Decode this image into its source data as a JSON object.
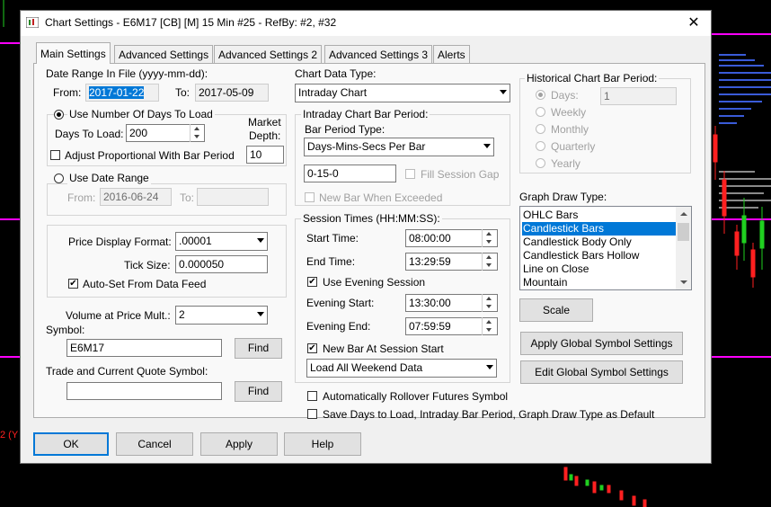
{
  "window": {
    "title": "Chart Settings - E6M17 [CB] [M]  15 Min  #25 - RefBy: #2, #32",
    "close_glyph": "✕"
  },
  "tabs": [
    {
      "label": "Main Settings",
      "active": true
    },
    {
      "label": "Advanced Settings"
    },
    {
      "label": "Advanced Settings 2"
    },
    {
      "label": "Advanced Settings 3"
    },
    {
      "label": "Alerts"
    }
  ],
  "date_range": {
    "label": "Date Range In File (yyyy-mm-dd):",
    "from_label": "From:",
    "from_value": "2017-01-22",
    "to_label": "To:",
    "to_value": "2017-05-09"
  },
  "days_group": {
    "radio_label": "Use Number Of Days To Load",
    "days_label": "Days To Load:",
    "days_value": "200",
    "market_depth_label1": "Market",
    "market_depth_label2": "Depth:",
    "market_depth_value": "10",
    "adjust_label": "Adjust Proportional With Bar Period"
  },
  "date_range_group": {
    "radio_label": "Use Date Range",
    "from_label": "From:",
    "from_value": "2016-06-24",
    "to_label": "To:",
    "to_value": ""
  },
  "price_group": {
    "format_label": "Price Display Format:",
    "format_value": ".00001",
    "tick_label": "Tick Size:",
    "tick_value": "0.000050",
    "autoset_label": "Auto-Set From Data Feed"
  },
  "volume": {
    "label": "Volume at Price Mult.:",
    "value": "2"
  },
  "symbol": {
    "label": "Symbol:",
    "value": "E6M17",
    "find_label": "Find"
  },
  "trade_symbol": {
    "label": "Trade and Current Quote Symbol:",
    "value": "",
    "find_label": "Find"
  },
  "chart_data_type": {
    "label": "Chart Data Type:",
    "value": "Intraday Chart"
  },
  "intraday_group": {
    "label": "Intraday Chart Bar Period:",
    "bar_period_type_label": "Bar Period Type:",
    "bar_period_type_value": "Days-Mins-Secs Per Bar",
    "period_value": "0-15-0",
    "fill_gap_label": "Fill Session Gap",
    "new_bar_label": "New Bar When Exceeded"
  },
  "session_group": {
    "label": "Session Times (HH:MM:SS):",
    "start_label": "Start Time:",
    "start_value": "08:00:00",
    "end_label": "End Time:",
    "end_value": "13:29:59",
    "use_evening_label": "Use Evening Session",
    "evening_start_label": "Evening Start:",
    "evening_start_value": "13:30:00",
    "evening_end_label": "Evening End:",
    "evening_end_value": "07:59:59",
    "new_bar_session_label": "New Bar At Session Start",
    "weekend_value": "Load All Weekend Data"
  },
  "auto_rollover_label": "Automatically Rollover Futures Symbol",
  "save_default_label": "Save Days to Load, Intraday Bar Period, Graph Draw Type as Default",
  "historical_group": {
    "label": "Historical Chart Bar Period:",
    "options": [
      "Days:",
      "Weekly",
      "Monthly",
      "Quarterly",
      "Yearly"
    ],
    "days_value": "1"
  },
  "graph_draw": {
    "label": "Graph Draw Type:",
    "items": [
      "OHLC Bars",
      "Candlestick Bars",
      "Candlestick Body Only",
      "Candlestick Bars Hollow",
      "Line on Close",
      "Mountain"
    ],
    "selected_index": 1
  },
  "buttons": {
    "scale": "Scale",
    "apply_global": "Apply Global Symbol Settings",
    "edit_global": "Edit Global Symbol Settings",
    "ok": "OK",
    "cancel": "Cancel",
    "apply": "Apply",
    "help": "Help"
  },
  "background": {
    "side_label": "2  (Y"
  },
  "colors": {
    "selection": "#0078d7",
    "magenta": "#ff00ff",
    "chart_bg": "#000000"
  }
}
